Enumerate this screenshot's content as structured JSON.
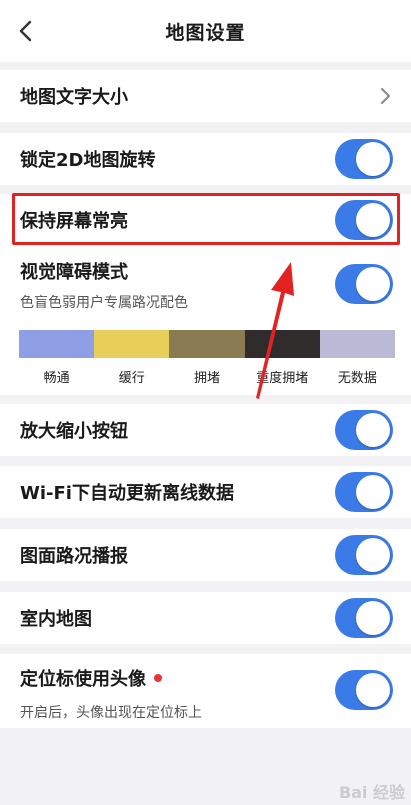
{
  "header": {
    "title": "地图设置"
  },
  "rows": {
    "font_size": {
      "label": "地图文字大小"
    },
    "lock_rotation": {
      "label": "锁定2D地图旋转",
      "on": true
    },
    "keep_screen": {
      "label": "保持屏幕常亮",
      "on": true
    },
    "visual_mode": {
      "label": "视觉障碍模式",
      "sub": "色盲色弱用户专属路况配色",
      "on": true
    },
    "zoom_buttons": {
      "label": "放大缩小按钮",
      "on": true
    },
    "wifi_update": {
      "label": "Wi-Fi下自动更新离线数据",
      "on": true
    },
    "traffic_report": {
      "label": "图面路况播报",
      "on": true
    },
    "indoor_map": {
      "label": "室内地图",
      "on": true
    },
    "avatar_marker": {
      "label": "定位标使用头像",
      "sub": "开启后，头像出现在定位标上",
      "on": true
    }
  },
  "legend": [
    {
      "label": "畅通",
      "color": "#8f9fe6"
    },
    {
      "label": "缓行",
      "color": "#e8cf5a"
    },
    {
      "label": "拥堵",
      "color": "#8b7b52"
    },
    {
      "label": "重度拥堵",
      "color": "#302c2c"
    },
    {
      "label": "无数据",
      "color": "#bab9d6"
    }
  ],
  "colors": {
    "toggle_on": "#3b7be8",
    "highlight": "#e32222",
    "arrow": "#e32222"
  },
  "watermark": "Bai 经验"
}
